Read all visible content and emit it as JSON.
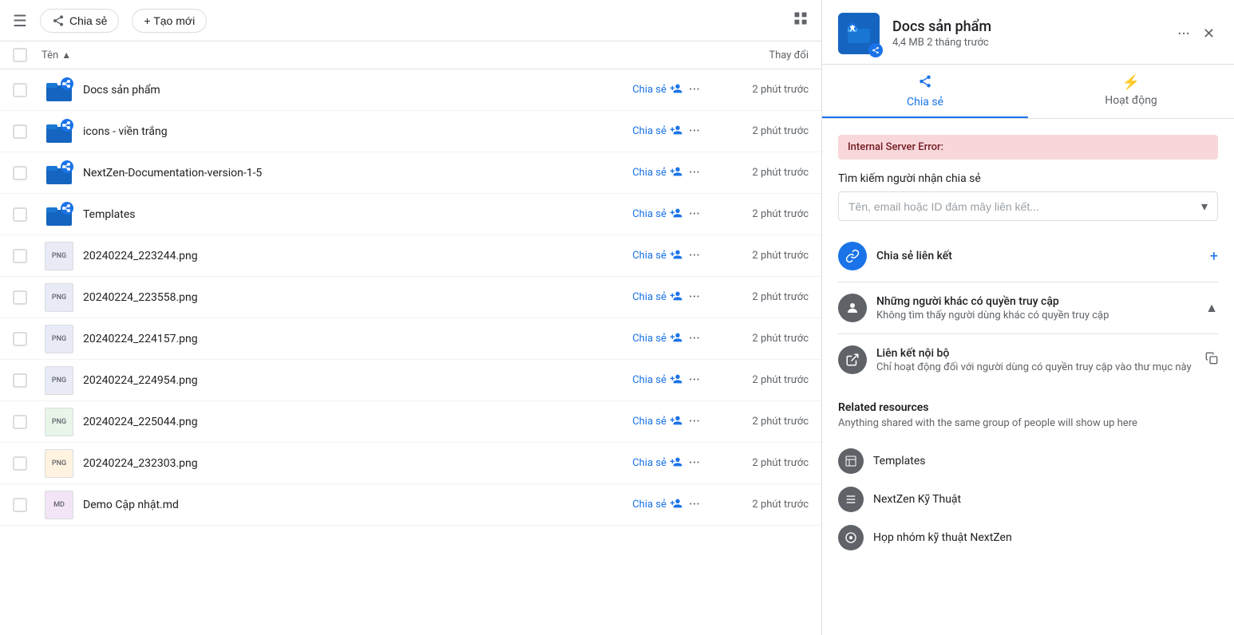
{
  "toolbar": {
    "menu_label": "☰",
    "share_label": "Chia sẻ",
    "new_label": "+ Tạo mới",
    "grid_label": "⊞"
  },
  "table": {
    "header_name": "Tên",
    "header_modified": "Thay đổi",
    "sort_arrow": "▲"
  },
  "files": [
    {
      "id": 1,
      "name": "Docs sản phẩm",
      "type": "folder-shared",
      "share_label": "Chia sẻ",
      "modified": "2 phút trước"
    },
    {
      "id": 2,
      "name": "icons - viền trắng",
      "type": "folder-shared",
      "share_label": "Chia sẻ",
      "modified": "2 phút trước"
    },
    {
      "id": 3,
      "name": "NextZen-Documentation-version-1-5",
      "type": "folder-shared",
      "share_label": "Chia sẻ",
      "modified": "2 phút trước"
    },
    {
      "id": 4,
      "name": "Templates",
      "type": "folder-shared",
      "share_label": "Chia sẻ",
      "modified": "2 phút trước"
    },
    {
      "id": 5,
      "name": "20240224_223244.png",
      "type": "png",
      "share_label": "Chia sẻ",
      "modified": "2 phút trước"
    },
    {
      "id": 6,
      "name": "20240224_223558.png",
      "type": "png",
      "share_label": "Chia sẻ",
      "modified": "2 phút trước"
    },
    {
      "id": 7,
      "name": "20240224_224157.png",
      "type": "png",
      "share_label": "Chia sẻ",
      "modified": "2 phút trước"
    },
    {
      "id": 8,
      "name": "20240224_224954.png",
      "type": "png",
      "share_label": "Chia sẻ",
      "modified": "2 phút trước"
    },
    {
      "id": 9,
      "name": "20240224_225044.png",
      "type": "png-chart",
      "share_label": "Chia sẻ",
      "modified": "2 phút trước"
    },
    {
      "id": 10,
      "name": "20240224_232303.png",
      "type": "png-colored",
      "share_label": "Chia sẻ",
      "modified": "2 phút trước"
    },
    {
      "id": 11,
      "name": "Demo Cập nhật.md",
      "type": "md",
      "share_label": "Chia sẻ",
      "modified": "2 phút trước"
    }
  ],
  "right_panel": {
    "folder_name": "Docs sản phẩm",
    "folder_meta": "4,4 MB 2 tháng trước",
    "more_icon": "···",
    "close_icon": "✕",
    "tabs": [
      {
        "id": "share",
        "icon": "⬆",
        "label": "Chia sẻ",
        "active": true
      },
      {
        "id": "activity",
        "icon": "⚡",
        "label": "Hoạt động",
        "active": false
      }
    ],
    "error_text": "Internal Server Error:",
    "share_search": {
      "label": "Tìm kiếm người nhận chia sẻ",
      "placeholder": "Tên, email hoặc ID đám mây liên kết..."
    },
    "share_rows": [
      {
        "id": "link",
        "icon_type": "link",
        "icon_char": "🔗",
        "title": "Chia sẻ liên kết",
        "sub": "",
        "action": "+",
        "action_type": "add"
      },
      {
        "id": "others",
        "icon_type": "others",
        "icon_char": "···",
        "title": "Những người khác có quyền truy cập",
        "sub": "Không tìm thấy người dùng khác có quyền truy cập",
        "action": "▲",
        "action_type": "expand"
      },
      {
        "id": "internal",
        "icon_type": "internal",
        "icon_char": "↗",
        "title": "Liên kết nội bộ",
        "sub": "Chỉ hoạt động đối với người dùng có quyền truy cập vào thư mục này",
        "action": "📋",
        "action_type": "copy"
      }
    ],
    "related": {
      "title": "Related resources",
      "sub": "Anything shared with the same group of people will show up here",
      "items": [
        {
          "id": 1,
          "label": "Templates",
          "icon_char": "📁"
        },
        {
          "id": 2,
          "label": "NextZen Kỹ Thuật",
          "icon_char": "≡"
        },
        {
          "id": 3,
          "label": "Họp nhóm kỹ thuật NextZen",
          "icon_char": "⊙"
        }
      ]
    }
  }
}
